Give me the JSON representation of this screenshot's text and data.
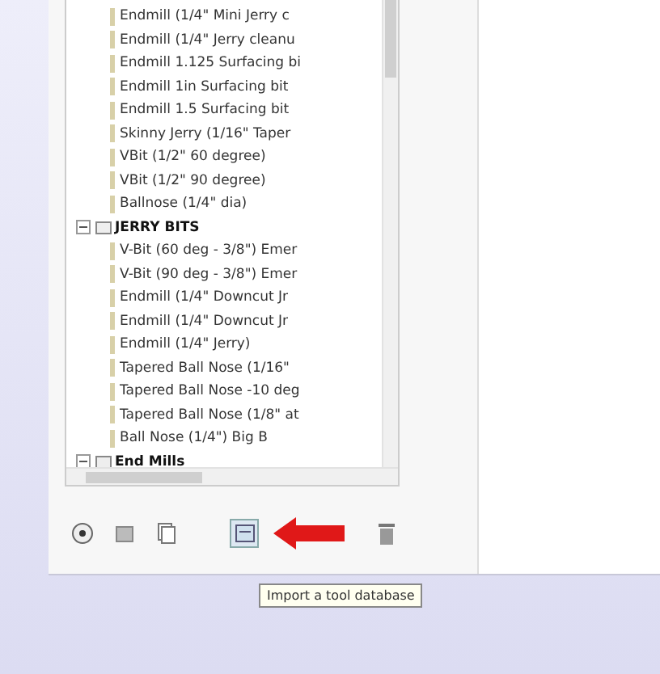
{
  "tree": {
    "items": [
      {
        "label": "Endmill (1/4\" Mini Jerry c"
      },
      {
        "label": "Endmill (1/4\" Jerry cleanu"
      },
      {
        "label": "Endmill 1.125 Surfacing bi"
      },
      {
        "label": "Endmill 1in Surfacing bit"
      },
      {
        "label": "Endmill 1.5 Surfacing bit"
      },
      {
        "label": "Skinny Jerry (1/16\" Taper"
      },
      {
        "label": "VBit (1/2\" 60 degree)"
      },
      {
        "label": "VBit (1/2\" 90 degree)"
      },
      {
        "label": "Ballnose (1/4\" dia)"
      },
      {
        "label": "JERRY BITS",
        "expanded": true,
        "children": [
          {
            "label": "V-Bit (60 deg - 3/8\") Emer"
          },
          {
            "label": "V-Bit (90 deg - 3/8\") Emer"
          },
          {
            "label": "Endmill (1/4\" Downcut Jr"
          },
          {
            "label": "Endmill (1/4\" Downcut Jr"
          },
          {
            "label": "Endmill (1/4\" Jerry)"
          },
          {
            "label": "Tapered Ball Nose (1/16\""
          },
          {
            "label": "Tapered Ball Nose -10 deg"
          },
          {
            "label": "Tapered Ball Nose (1/8\" at"
          },
          {
            "label": "Ball Nose (1/4\") Big B"
          }
        ]
      },
      {
        "label": "End Mills",
        "expanded": true
      }
    ]
  },
  "tooltip": "Import a tool database"
}
